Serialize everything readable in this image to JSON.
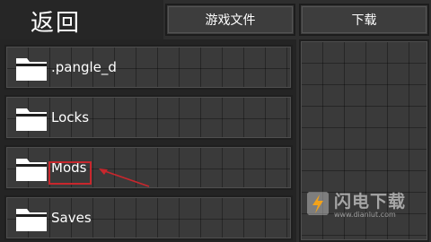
{
  "header": {
    "back_label": "返回",
    "tabs": [
      {
        "label": "游戏文件"
      },
      {
        "label": "下载"
      }
    ]
  },
  "file_list": {
    "items": [
      {
        "name": ".pangle_d",
        "icon": "folder-icon"
      },
      {
        "name": "Locks",
        "icon": "folder-icon"
      },
      {
        "name": "Mods",
        "icon": "folder-icon",
        "highlighted": true
      },
      {
        "name": "Saves",
        "icon": "folder-icon"
      }
    ]
  },
  "annotation": {
    "highlight_color": "#c8272d"
  },
  "watermark": {
    "title": "闪电下载",
    "url": "www.dianlut.com"
  }
}
